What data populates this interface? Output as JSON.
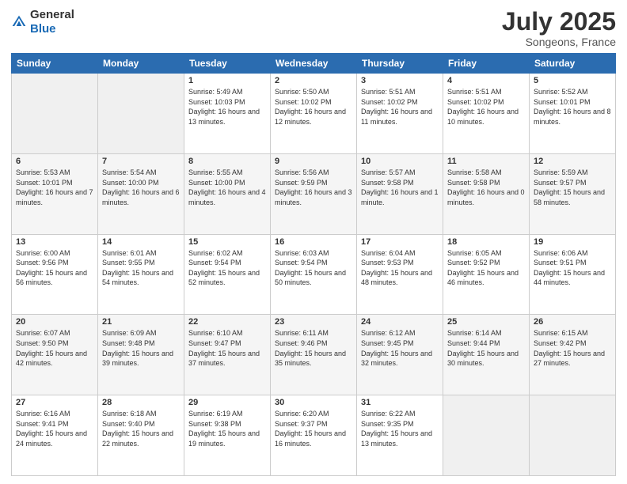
{
  "logo": {
    "general": "General",
    "blue": "Blue"
  },
  "header": {
    "month_year": "July 2025",
    "location": "Songeons, France"
  },
  "weekdays": [
    "Sunday",
    "Monday",
    "Tuesday",
    "Wednesday",
    "Thursday",
    "Friday",
    "Saturday"
  ],
  "weeks": [
    [
      {
        "day": "",
        "sunrise": "",
        "sunset": "",
        "daylight": ""
      },
      {
        "day": "",
        "sunrise": "",
        "sunset": "",
        "daylight": ""
      },
      {
        "day": "1",
        "sunrise": "Sunrise: 5:49 AM",
        "sunset": "Sunset: 10:03 PM",
        "daylight": "Daylight: 16 hours and 13 minutes."
      },
      {
        "day": "2",
        "sunrise": "Sunrise: 5:50 AM",
        "sunset": "Sunset: 10:02 PM",
        "daylight": "Daylight: 16 hours and 12 minutes."
      },
      {
        "day": "3",
        "sunrise": "Sunrise: 5:51 AM",
        "sunset": "Sunset: 10:02 PM",
        "daylight": "Daylight: 16 hours and 11 minutes."
      },
      {
        "day": "4",
        "sunrise": "Sunrise: 5:51 AM",
        "sunset": "Sunset: 10:02 PM",
        "daylight": "Daylight: 16 hours and 10 minutes."
      },
      {
        "day": "5",
        "sunrise": "Sunrise: 5:52 AM",
        "sunset": "Sunset: 10:01 PM",
        "daylight": "Daylight: 16 hours and 8 minutes."
      }
    ],
    [
      {
        "day": "6",
        "sunrise": "Sunrise: 5:53 AM",
        "sunset": "Sunset: 10:01 PM",
        "daylight": "Daylight: 16 hours and 7 minutes."
      },
      {
        "day": "7",
        "sunrise": "Sunrise: 5:54 AM",
        "sunset": "Sunset: 10:00 PM",
        "daylight": "Daylight: 16 hours and 6 minutes."
      },
      {
        "day": "8",
        "sunrise": "Sunrise: 5:55 AM",
        "sunset": "Sunset: 10:00 PM",
        "daylight": "Daylight: 16 hours and 4 minutes."
      },
      {
        "day": "9",
        "sunrise": "Sunrise: 5:56 AM",
        "sunset": "Sunset: 9:59 PM",
        "daylight": "Daylight: 16 hours and 3 minutes."
      },
      {
        "day": "10",
        "sunrise": "Sunrise: 5:57 AM",
        "sunset": "Sunset: 9:58 PM",
        "daylight": "Daylight: 16 hours and 1 minute."
      },
      {
        "day": "11",
        "sunrise": "Sunrise: 5:58 AM",
        "sunset": "Sunset: 9:58 PM",
        "daylight": "Daylight: 16 hours and 0 minutes."
      },
      {
        "day": "12",
        "sunrise": "Sunrise: 5:59 AM",
        "sunset": "Sunset: 9:57 PM",
        "daylight": "Daylight: 15 hours and 58 minutes."
      }
    ],
    [
      {
        "day": "13",
        "sunrise": "Sunrise: 6:00 AM",
        "sunset": "Sunset: 9:56 PM",
        "daylight": "Daylight: 15 hours and 56 minutes."
      },
      {
        "day": "14",
        "sunrise": "Sunrise: 6:01 AM",
        "sunset": "Sunset: 9:55 PM",
        "daylight": "Daylight: 15 hours and 54 minutes."
      },
      {
        "day": "15",
        "sunrise": "Sunrise: 6:02 AM",
        "sunset": "Sunset: 9:54 PM",
        "daylight": "Daylight: 15 hours and 52 minutes."
      },
      {
        "day": "16",
        "sunrise": "Sunrise: 6:03 AM",
        "sunset": "Sunset: 9:54 PM",
        "daylight": "Daylight: 15 hours and 50 minutes."
      },
      {
        "day": "17",
        "sunrise": "Sunrise: 6:04 AM",
        "sunset": "Sunset: 9:53 PM",
        "daylight": "Daylight: 15 hours and 48 minutes."
      },
      {
        "day": "18",
        "sunrise": "Sunrise: 6:05 AM",
        "sunset": "Sunset: 9:52 PM",
        "daylight": "Daylight: 15 hours and 46 minutes."
      },
      {
        "day": "19",
        "sunrise": "Sunrise: 6:06 AM",
        "sunset": "Sunset: 9:51 PM",
        "daylight": "Daylight: 15 hours and 44 minutes."
      }
    ],
    [
      {
        "day": "20",
        "sunrise": "Sunrise: 6:07 AM",
        "sunset": "Sunset: 9:50 PM",
        "daylight": "Daylight: 15 hours and 42 minutes."
      },
      {
        "day": "21",
        "sunrise": "Sunrise: 6:09 AM",
        "sunset": "Sunset: 9:48 PM",
        "daylight": "Daylight: 15 hours and 39 minutes."
      },
      {
        "day": "22",
        "sunrise": "Sunrise: 6:10 AM",
        "sunset": "Sunset: 9:47 PM",
        "daylight": "Daylight: 15 hours and 37 minutes."
      },
      {
        "day": "23",
        "sunrise": "Sunrise: 6:11 AM",
        "sunset": "Sunset: 9:46 PM",
        "daylight": "Daylight: 15 hours and 35 minutes."
      },
      {
        "day": "24",
        "sunrise": "Sunrise: 6:12 AM",
        "sunset": "Sunset: 9:45 PM",
        "daylight": "Daylight: 15 hours and 32 minutes."
      },
      {
        "day": "25",
        "sunrise": "Sunrise: 6:14 AM",
        "sunset": "Sunset: 9:44 PM",
        "daylight": "Daylight: 15 hours and 30 minutes."
      },
      {
        "day": "26",
        "sunrise": "Sunrise: 6:15 AM",
        "sunset": "Sunset: 9:42 PM",
        "daylight": "Daylight: 15 hours and 27 minutes."
      }
    ],
    [
      {
        "day": "27",
        "sunrise": "Sunrise: 6:16 AM",
        "sunset": "Sunset: 9:41 PM",
        "daylight": "Daylight: 15 hours and 24 minutes."
      },
      {
        "day": "28",
        "sunrise": "Sunrise: 6:18 AM",
        "sunset": "Sunset: 9:40 PM",
        "daylight": "Daylight: 15 hours and 22 minutes."
      },
      {
        "day": "29",
        "sunrise": "Sunrise: 6:19 AM",
        "sunset": "Sunset: 9:38 PM",
        "daylight": "Daylight: 15 hours and 19 minutes."
      },
      {
        "day": "30",
        "sunrise": "Sunrise: 6:20 AM",
        "sunset": "Sunset: 9:37 PM",
        "daylight": "Daylight: 15 hours and 16 minutes."
      },
      {
        "day": "31",
        "sunrise": "Sunrise: 6:22 AM",
        "sunset": "Sunset: 9:35 PM",
        "daylight": "Daylight: 15 hours and 13 minutes."
      },
      {
        "day": "",
        "sunrise": "",
        "sunset": "",
        "daylight": ""
      },
      {
        "day": "",
        "sunrise": "",
        "sunset": "",
        "daylight": ""
      }
    ]
  ]
}
